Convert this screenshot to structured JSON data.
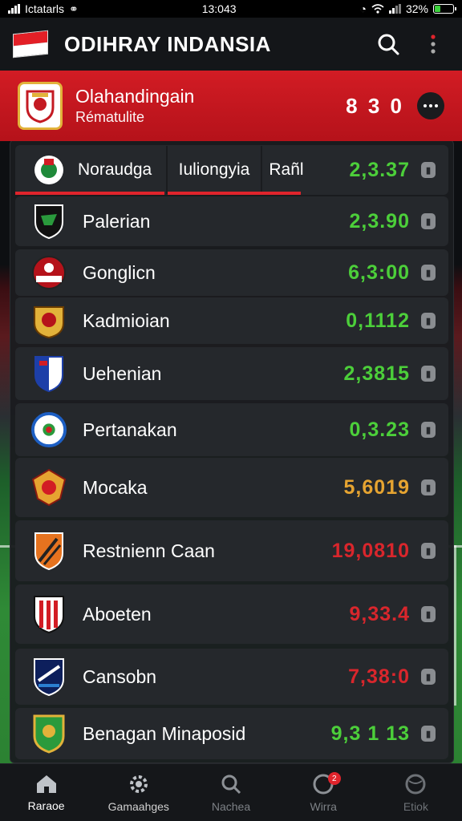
{
  "status_bar": {
    "carrier": "Ictatarls",
    "time": "13:043",
    "battery": "32%"
  },
  "app": {
    "title": "ODIHRAY INDANSIA"
  },
  "featured": {
    "title": "Olahandingain",
    "subtitle": "Rématulite",
    "score": "8 3 0"
  },
  "tabs": {
    "first": "Noraudga",
    "second": "Iuliongyia",
    "third": "Rañl",
    "value": "2,3.37"
  },
  "teams": [
    {
      "name": "Palerian",
      "value": "2,3.90",
      "color": "#4ccf3a"
    },
    {
      "name": "Gonglicn",
      "value": "6,3:00",
      "color": "#4ccf3a"
    },
    {
      "name": "Kadmioian",
      "value": "0,1112",
      "color": "#4ccf3a"
    },
    {
      "name": "Uehenian",
      "value": "2,3815",
      "color": "#4ccf3a"
    },
    {
      "name": "Pertanakan",
      "value": "0,3.23",
      "color": "#4ccf3a"
    },
    {
      "name": "Mocaka",
      "value": "5,6019",
      "color": "#e6a431"
    },
    {
      "name": "Restnienn Caan",
      "value": "19,0810",
      "color": "#d9262c"
    },
    {
      "name": "Aboeten",
      "value": "9,33.4",
      "color": "#d9262c"
    },
    {
      "name": "Cansobn",
      "value": "7,38:0",
      "color": "#d9262c"
    },
    {
      "name": "Benagan Minaposid",
      "value": "9,3 1 13",
      "color": "#4ccf3a"
    }
  ],
  "bottom_nav": [
    {
      "label": "Raraoe",
      "icon": "home-icon"
    },
    {
      "label": "Gamaahges",
      "icon": "gear-icon"
    },
    {
      "label": "Nachea",
      "icon": "search-icon"
    },
    {
      "label": "Wirra",
      "icon": "notification-icon",
      "badge": "2"
    },
    {
      "label": "Etiok",
      "icon": "globe-icon"
    }
  ],
  "colors": {
    "accent": "#d21c24",
    "green": "#4ccf3a",
    "orange": "#e6a431",
    "red": "#d9262c"
  }
}
